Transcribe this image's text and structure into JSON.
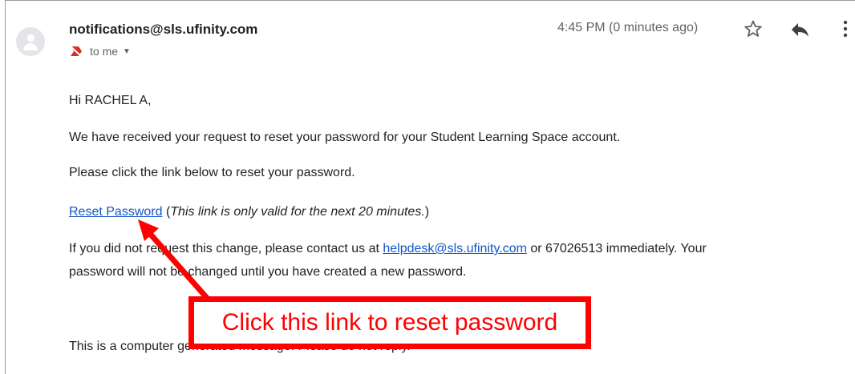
{
  "email": {
    "sender": "notifications@sls.ufinity.com",
    "recipient_label": "to me",
    "time": "4:45 PM (0 minutes ago)"
  },
  "body": {
    "greeting": "Hi RACHEL A,",
    "line1": "We have received your request to reset your password for your Student Learning Space account.",
    "line2": "Please click the link below to reset your password.",
    "reset_link": "Reset Password",
    "validity_open": " (",
    "validity_note": "This link is only valid for the next 20 minutes.",
    "validity_close": ")",
    "line4_prefix": "If you did not request this change, please contact us at ",
    "helpdesk_email": "helpdesk@sls.ufinity.com",
    "line4_suffix": " or 67026513 immediately. Your",
    "line5": "password will not be changed until you have created a new password.",
    "footer": "This is a computer generated message. Please do not reply."
  },
  "annotation": {
    "callout_text": "Click this link to reset password",
    "color": "#ff0000"
  },
  "icons": {
    "avatar": "person-icon",
    "important": "important-marker-icon",
    "recipients": "chevron-down-icon",
    "star": "star-icon",
    "reply": "reply-icon",
    "more": "more-vertical-icon"
  }
}
